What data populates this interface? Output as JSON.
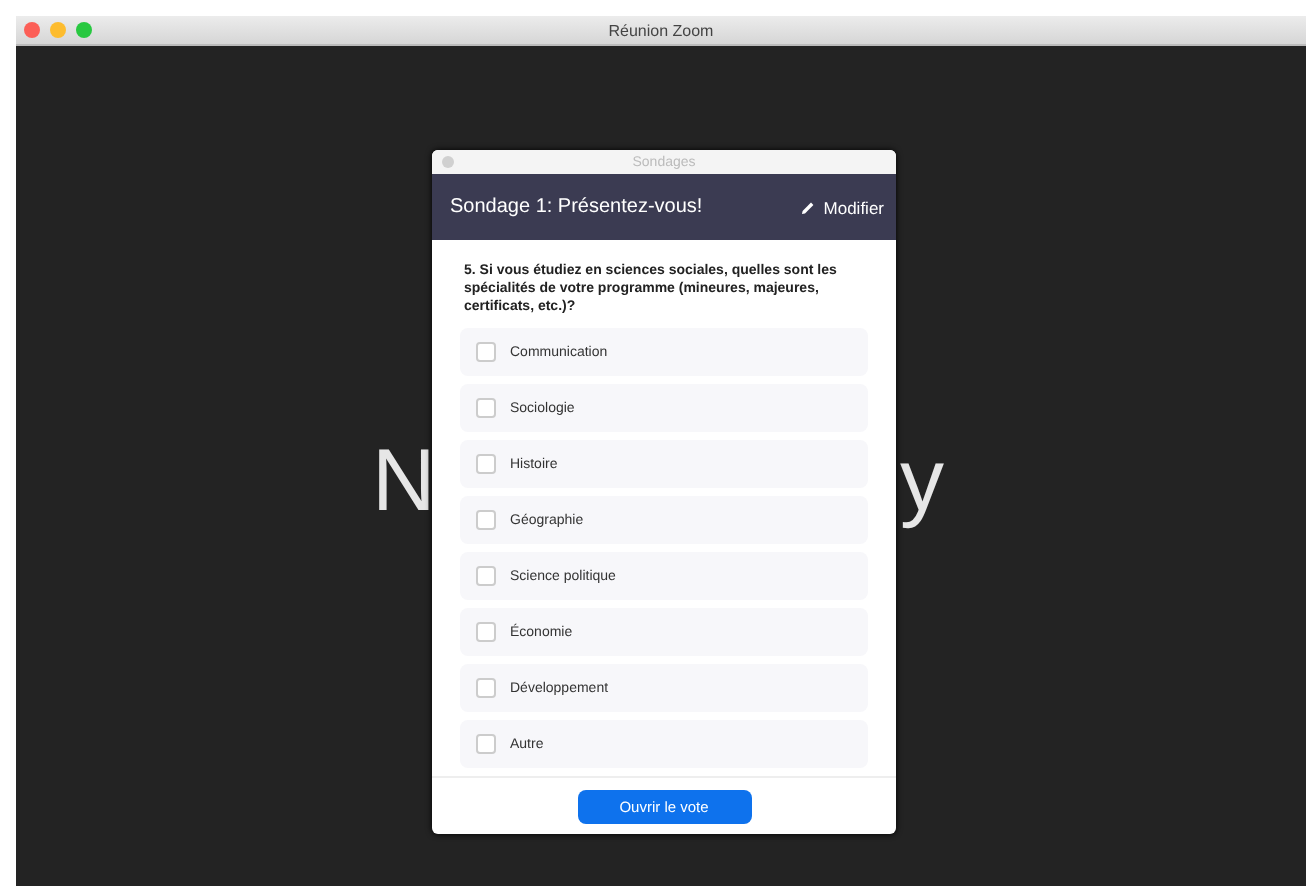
{
  "window": {
    "title": "Réunion Zoom"
  },
  "participant_name": {
    "left": "N",
    "right": "y"
  },
  "dialog": {
    "title": "Sondages",
    "poll_title": "Sondage 1: Présentez-vous!",
    "edit_label": "Modifier",
    "question": "5. Si vous étudiez en sciences sociales, quelles sont les spécialités de votre programme (mineures, majeures, certificats, etc.)?",
    "options": [
      {
        "label": "Communication",
        "checked": false
      },
      {
        "label": "Sociologie",
        "checked": false
      },
      {
        "label": "Histoire",
        "checked": false
      },
      {
        "label": "Géographie",
        "checked": false
      },
      {
        "label": "Science politique",
        "checked": false
      },
      {
        "label": "Économie",
        "checked": false
      },
      {
        "label": "Développement",
        "checked": false
      },
      {
        "label": "Autre",
        "checked": false
      }
    ],
    "button": "Ouvrir le vote"
  }
}
